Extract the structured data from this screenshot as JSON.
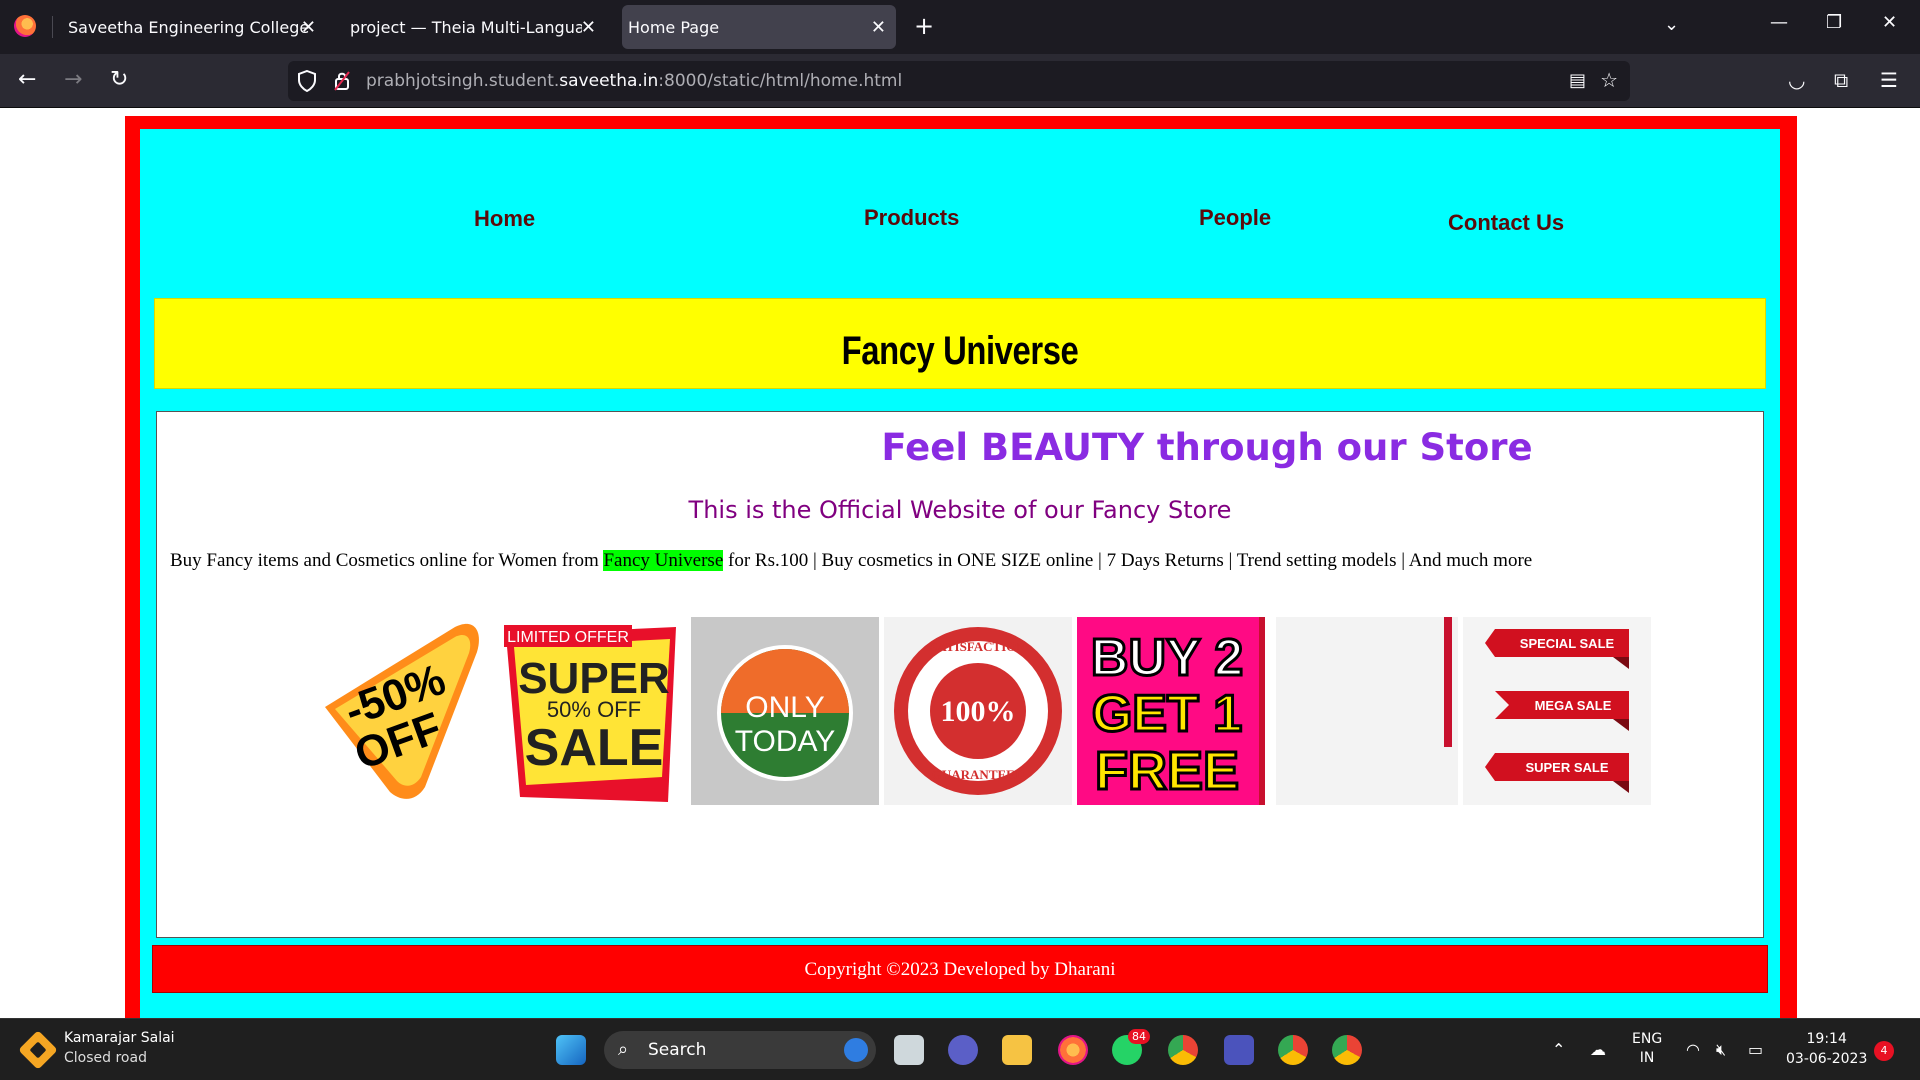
{
  "browser": {
    "tabs": [
      {
        "title": "Saveetha Engineering College"
      },
      {
        "title": "project — Theia Multi-Language Ex"
      },
      {
        "title": "Home Page"
      }
    ],
    "url_prefix": "prabhjotsingh.student.",
    "url_host": "saveetha.in",
    "url_suffix": ":8000/static/html/home.html"
  },
  "site": {
    "nav": [
      "Home",
      "Products",
      "People",
      "Contact Us"
    ],
    "brand": "Fancy Universe",
    "headline": "Feel BEAUTY through our Store",
    "subheadline": "This is the Official Website of our Fancy Store",
    "description_before": "Buy Fancy items and Cosmetics online for Women from ",
    "description_highlight": "Fancy Universe",
    "description_after": " for Rs.100 | Buy cosmetics in ONE SIZE online | 7 Days Returns | Trend setting models | And much more",
    "images": {
      "img1": [
        "-50%",
        "OFF"
      ],
      "img2": [
        "LIMITED OFFER",
        "SUPER",
        "50% OFF",
        "SALE"
      ],
      "img3": [
        "ONLY",
        "TODAY"
      ],
      "img4": [
        "SATISFACTION",
        "100%",
        "GUARANTEED"
      ],
      "img5": [
        "BUY 2",
        "GET 1",
        "FREE"
      ],
      "img7": [
        "SPECIAL SALE",
        "MEGA SALE",
        "SUPER SALE"
      ]
    },
    "footer": "Copyright ©2023 Developed by Dharani",
    "colors": {
      "border": "#ff0000",
      "panel": "#00ffff",
      "banner": "#ffff00",
      "headline": "#8a2be2",
      "subheadline": "#800080",
      "highlight": "#00ff00"
    }
  },
  "taskbar": {
    "weather_line1": "Kamarajar Salai",
    "weather_line2": "Closed road",
    "search_label": "Search",
    "whatsapp_badge": "84",
    "language_1": "ENG",
    "language_2": "IN",
    "time": "19:14",
    "date": "03-06-2023",
    "notification_count": "4"
  }
}
